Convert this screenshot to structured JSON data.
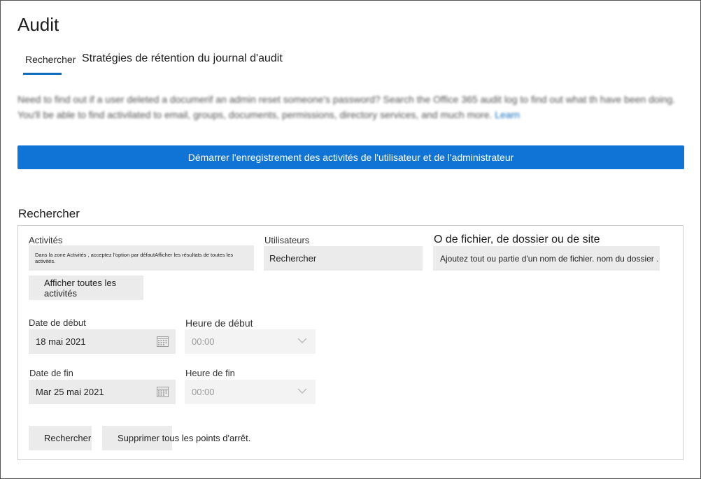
{
  "page": {
    "title": "Audit",
    "tabs": [
      {
        "label": "Rechercher",
        "active": true
      },
      {
        "label": "Stratégies de rétention du journal d'audit",
        "active": false
      }
    ],
    "intro_text": "Need to find out if a user deleted a documerif an admin reset someone's password? Search the Office 365 audit log to find out what th have been doing. You'll be able to find activilated to email, groups, documents, permissions, directory services, and much more.",
    "intro_link": "Learn",
    "start_recording_label": "Démarrer l'enregistrement des activités de l'utilisateur et de l'administrateur"
  },
  "search": {
    "section_title": "Rechercher",
    "activities_label": "Activités",
    "activities_value": "Dans la zone Activités , acceptez l'option par défautAfficher les résultats de toutes les activités.",
    "users_label": "Utilisateurs",
    "users_placeholder": "Rechercher",
    "file_label": "O de fichier, de dossier ou de site",
    "file_placeholder": "Ajoutez tout ou partie d'un nom de fichier. nom du dossier .",
    "show_all_activities_label": "Afficher toutes les activités",
    "start_date_label": "Date de début",
    "start_date_value": "18 mai 2021",
    "start_time_label": "Heure de début",
    "start_time_value": "00:00",
    "end_date_label": "Date de fin",
    "end_date_value": "Mar 25 mai 2021",
    "end_time_label": "Heure de fin",
    "end_time_value": "00:00",
    "search_button_label": "Rechercher",
    "clear_button_label": "Supprimer tous les points d'arrêt."
  },
  "colors": {
    "accent": "#0f74d6",
    "tab_underline": "#0f6cbd",
    "field_bg": "#ebebeb"
  }
}
